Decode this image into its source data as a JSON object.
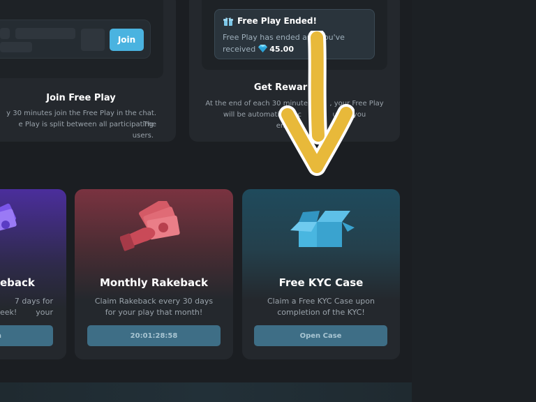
{
  "free_play_card": {
    "title": "Join Free Play",
    "desc_line1": "y 30 minutes join the Free Play in the chat. The",
    "desc_line2": "e Play is split between all participating users.",
    "join_label": "Join"
  },
  "rewards_card": {
    "title": "Get Rewar",
    "desc_line1": "At the end of each 30 minute i        , your Free Play",
    "desc_line2": "will be automatically c              unt if you",
    "desc_line3": "ente",
    "notification": {
      "title": "Free Play Ended!",
      "text_before": "Free Play has ended and you've received",
      "amount": "45.00"
    }
  },
  "weekly_card": {
    "title": "eback",
    "desc_line1": "7 days for your",
    "desc_line2": "eek!",
    "button_label": "n"
  },
  "monthly_card": {
    "title": "Monthly Rakeback",
    "desc": "Claim Rakeback every 30 days for your play that month!",
    "button_label": "20:01:28:58"
  },
  "kyc_card": {
    "title": "Free KYC Case",
    "desc": "Claim a Free KYC Case upon completion of the KYC!",
    "button_label": "Open Case"
  },
  "colors": {
    "accent_blue": "#4ab3e0",
    "arrow_yellow": "#e8b93a",
    "monthly_red": "#c84454",
    "weekly_purple": "#6a3fd0"
  },
  "icons": {
    "gift": "gift-icon",
    "gem": "gem-icon",
    "arrow": "arrow-down-icon",
    "cash": "cash-hand-icon",
    "box": "open-box-icon"
  }
}
